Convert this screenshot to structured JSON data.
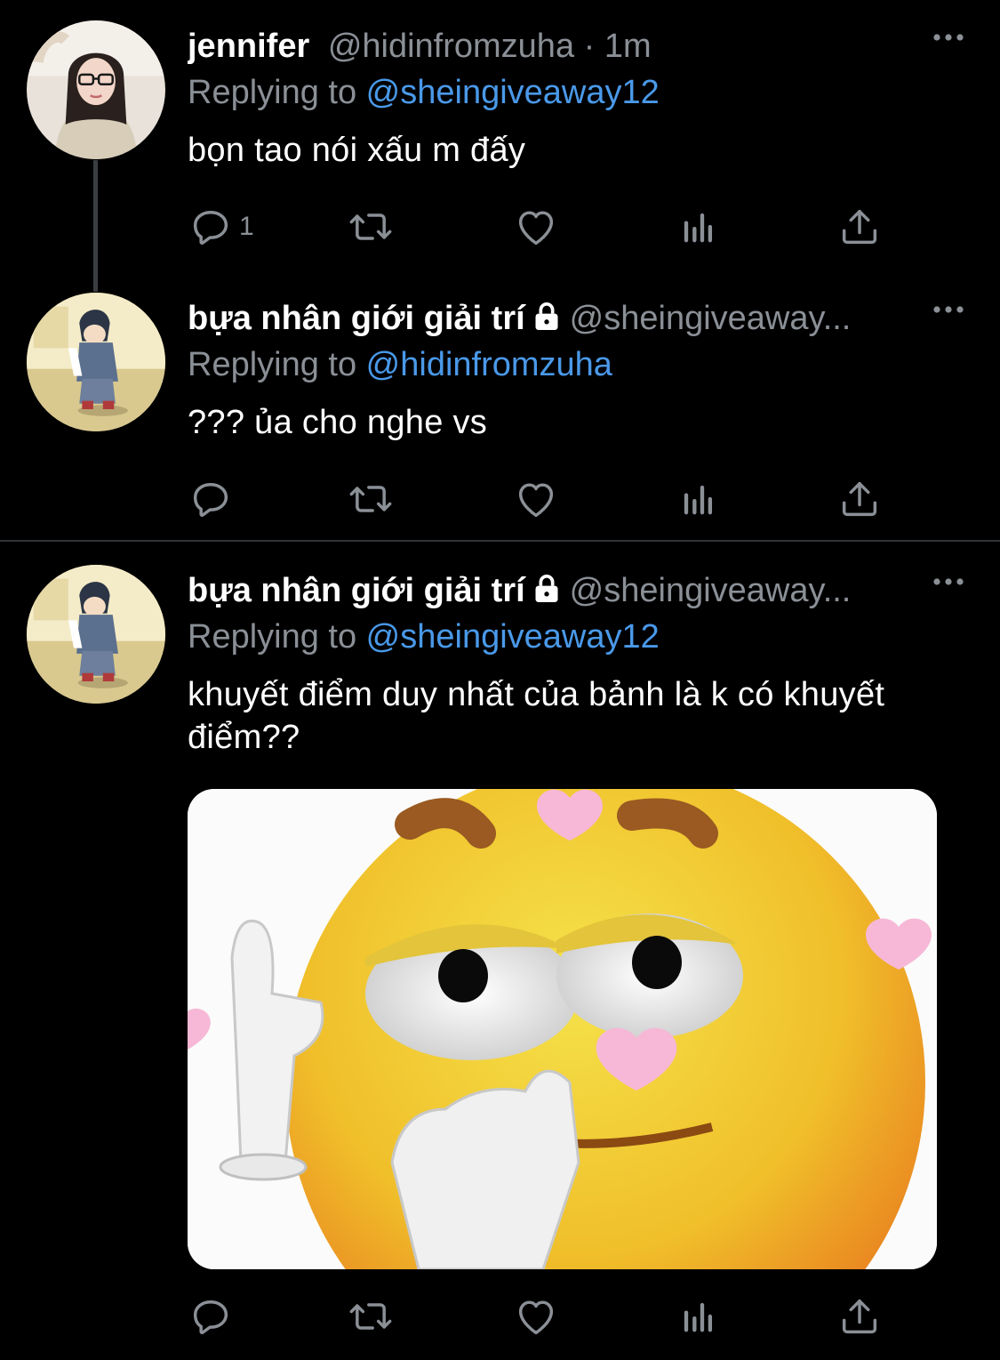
{
  "tweets": [
    {
      "name": "jennifer",
      "handle": "@hidinfromzuha · 1m",
      "replying_prefix": "Replying to ",
      "replying_to": "@sheingiveaway12",
      "text": "bọn tao nói xấu m đấy",
      "reply_count": "1"
    },
    {
      "name": "bựa nhân giới giải trí",
      "handle": "@sheingiveaway...",
      "replying_prefix": "Replying to ",
      "replying_to": "@hidinfromzuha",
      "text": "??? ủa cho nghe vs",
      "reply_count": ""
    },
    {
      "name": "bựa nhân giới giải trí",
      "handle": "@sheingiveaway...",
      "replying_prefix": "Replying to ",
      "replying_to": "@sheingiveaway12",
      "text_line1": "khuyết điểm duy nhất của bảnh là k có khuyết",
      "text_line2": "điểm??",
      "reply_count": ""
    }
  ],
  "icons": {
    "reply": "reply-icon",
    "retweet": "retweet-icon",
    "like": "heart-icon",
    "analytics": "analytics-icon",
    "share": "share-icon",
    "more": "more-icon",
    "lock": "lock-icon"
  },
  "colors": {
    "background": "#000000",
    "mention": "#4a99e9",
    "muted": "#8b9097",
    "text": "#ffffff"
  }
}
